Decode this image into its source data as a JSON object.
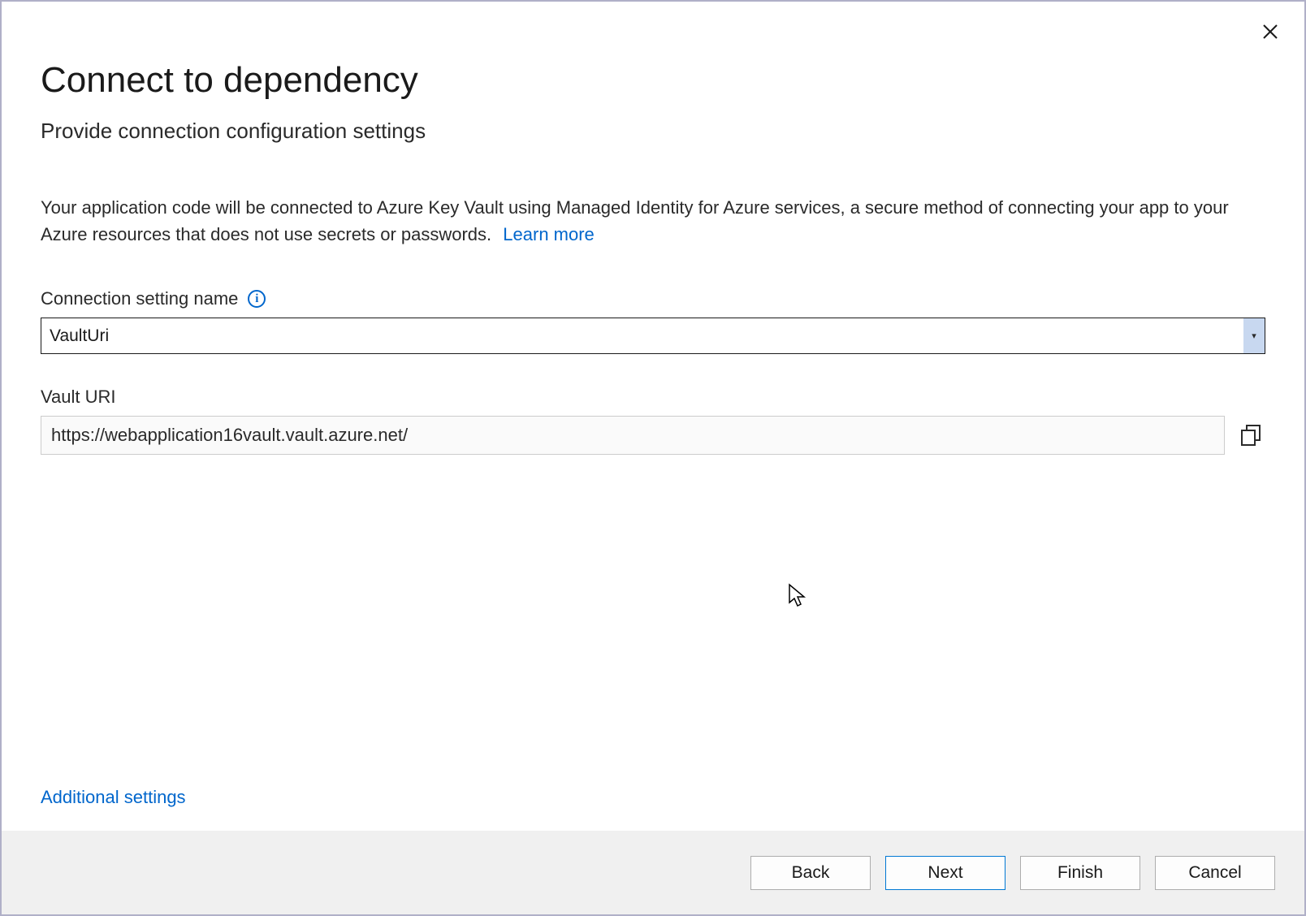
{
  "dialog": {
    "title": "Connect to dependency",
    "subtitle": "Provide connection configuration settings",
    "description_text": "Your application code will be connected to Azure Key Vault using Managed Identity for Azure services, a secure method of connecting your app to your Azure resources that does not use secrets or passwords.",
    "learn_more_label": "Learn more"
  },
  "fields": {
    "connection_setting": {
      "label": "Connection setting name",
      "value": "VaultUri"
    },
    "vault_uri": {
      "label": "Vault URI",
      "value": "https://webapplication16vault.vault.azure.net/"
    }
  },
  "links": {
    "additional_settings": "Additional settings"
  },
  "footer": {
    "back": "Back",
    "next": "Next",
    "finish": "Finish",
    "cancel": "Cancel"
  }
}
